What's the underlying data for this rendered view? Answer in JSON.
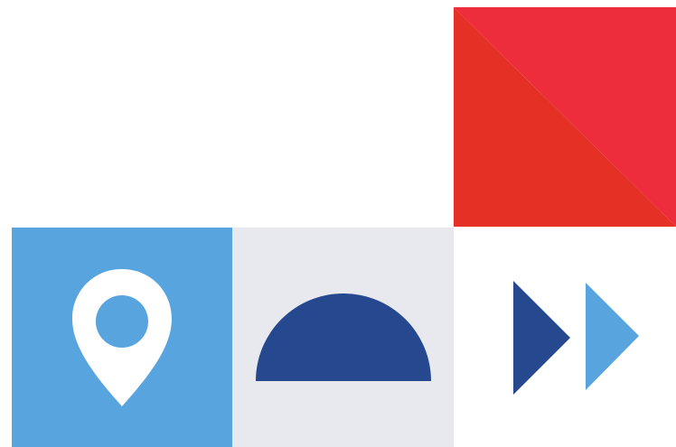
{
  "tiles": [
    {
      "name": "red-diagonal-square",
      "colors": {
        "primary": "#e43025",
        "secondary": "#ee2d3c"
      }
    },
    {
      "name": "location-pin-tile",
      "icon": "location-pin-icon",
      "colors": {
        "background": "#58a4de",
        "foreground": "#ffffff"
      }
    },
    {
      "name": "semicircle-tile",
      "colors": {
        "background": "#e8e9ee",
        "shape": "#25488e"
      }
    },
    {
      "name": "double-arrow-tile",
      "icon": "fast-forward-icon",
      "colors": {
        "background": "#ffffff",
        "left_arrow": "#25488e",
        "right_arrow": "#58a4de"
      }
    }
  ]
}
